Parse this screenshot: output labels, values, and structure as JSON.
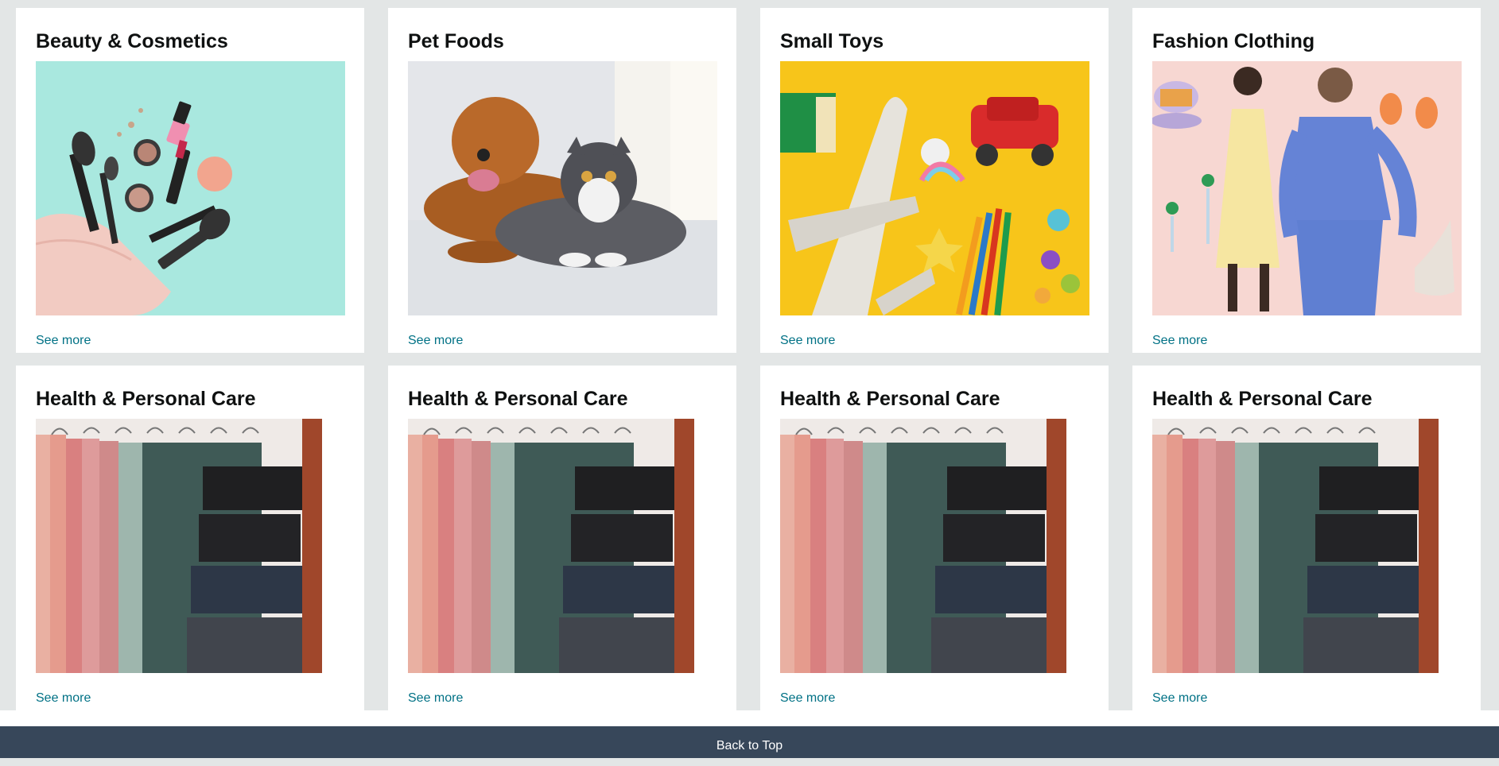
{
  "cards": [
    {
      "title": "Beauty & Cosmetics",
      "link": "See more",
      "image": "makeup-image"
    },
    {
      "title": "Pet Foods",
      "link": "See more",
      "image": "dog-and-cat-image"
    },
    {
      "title": "Small Toys",
      "link": "See more",
      "image": "toys-image"
    },
    {
      "title": "Fashion Clothing",
      "link": "See more",
      "image": "fashion-image"
    },
    {
      "title": "Health & Personal Care",
      "link": "See more",
      "image": "pants-hanger-image"
    },
    {
      "title": "Health & Personal Care",
      "link": "See more",
      "image": "pants-hanger-image"
    },
    {
      "title": "Health & Personal Care",
      "link": "See more",
      "image": "pants-hanger-image"
    },
    {
      "title": "Health & Personal Care",
      "link": "See more",
      "image": "pants-hanger-image"
    }
  ],
  "footer": {
    "back_to_top": "Back to Top"
  },
  "colors": {
    "page_bg": "#e3e6e6",
    "link": "#007185",
    "footer_bg": "#37475a"
  }
}
